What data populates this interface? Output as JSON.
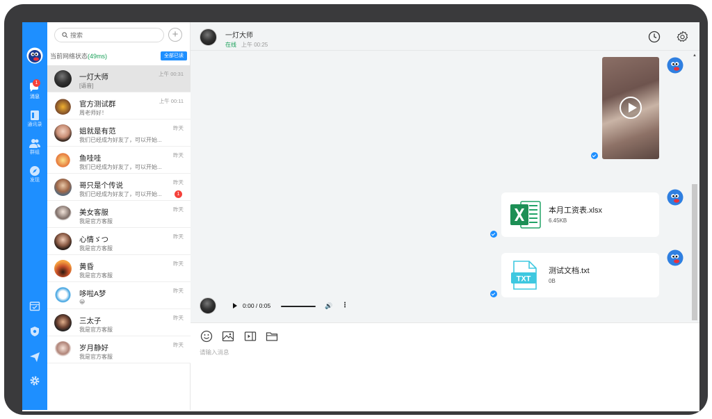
{
  "search": {
    "placeholder": "搜索"
  },
  "network": {
    "label": "当前网络状态",
    "latency": "(49ms)"
  },
  "read_all_label": "全部已读",
  "rail": {
    "messages_label": "消息",
    "messages_badge": "1",
    "contacts_label": "通讯录",
    "groups_label": "群组",
    "discover_label": "发现"
  },
  "conversations": [
    {
      "name": "一灯大师",
      "preview": "[语音]",
      "time": "上午 00:31",
      "badge": ""
    },
    {
      "name": "官方测试群",
      "preview": "周老师好！",
      "time": "上午 00:11",
      "badge": ""
    },
    {
      "name": "姐就是有范",
      "preview": "我们已经成为好友了，可以开始...",
      "time": "昨天",
      "badge": ""
    },
    {
      "name": "鱼哇哇",
      "preview": "我们已经成为好友了，可以开始...",
      "time": "昨天",
      "badge": ""
    },
    {
      "name": "哥只是个传说",
      "preview": "我们已经成为好友了，可以开始...",
      "time": "昨天",
      "badge": "1"
    },
    {
      "name": "美女客服",
      "preview": "我是官方客服",
      "time": "昨天",
      "badge": ""
    },
    {
      "name": "心情ゞつ",
      "preview": "我是官方客服",
      "time": "昨天",
      "badge": ""
    },
    {
      "name": "黄昏",
      "preview": "我是官方客服",
      "time": "昨天",
      "badge": ""
    },
    {
      "name": "哆啦A梦",
      "preview": "😀",
      "time": "昨天",
      "badge": ""
    },
    {
      "name": "三太子",
      "preview": "我是官方客服",
      "time": "昨天",
      "badge": ""
    },
    {
      "name": "岁月静好",
      "preview": "我是官方客服",
      "time": "昨天",
      "badge": ""
    }
  ],
  "chat": {
    "peer_name": "一灯大师",
    "peer_status": "在线",
    "peer_last_seen": "上午 00:25"
  },
  "messages": {
    "file1": {
      "name": "本月工资表.xlsx",
      "size": "6.45KB",
      "icon": "excel-icon"
    },
    "file2": {
      "name": "测试文档.txt",
      "size": "0B",
      "icon": "txt-icon"
    },
    "audio": {
      "time": "0:00 / 0:05"
    }
  },
  "composer": {
    "placeholder": "请输入消息"
  },
  "colors": {
    "brand": "#1e8fff",
    "online": "#18a058",
    "badge": "#f5413b"
  }
}
